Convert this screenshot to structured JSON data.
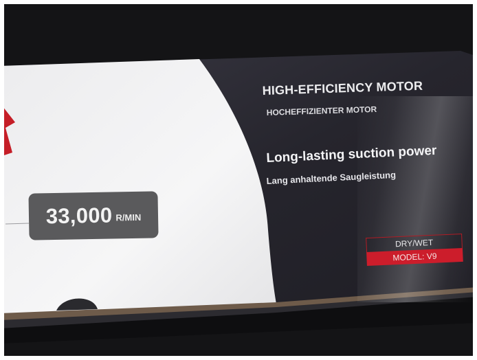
{
  "packaging": {
    "headline": "HIGH-EFFICIENCY MOTOR",
    "headline_de": "HOCHEFFIZIENTER MOTOR",
    "feature": "Long-lasting suction power",
    "feature_de": "Lang anhaltende Saugleistung",
    "speed_value": "33,000",
    "speed_unit": "R/MIN",
    "label_type": "DRY/WET",
    "label_model": "MODEL: V9"
  },
  "colors": {
    "panel_dark": "#2b2a33",
    "panel_white": "#f3f3f4",
    "badge_gray": "#5a5a5c",
    "accent_red": "#cc1d2b",
    "background_surface": "#141416"
  }
}
